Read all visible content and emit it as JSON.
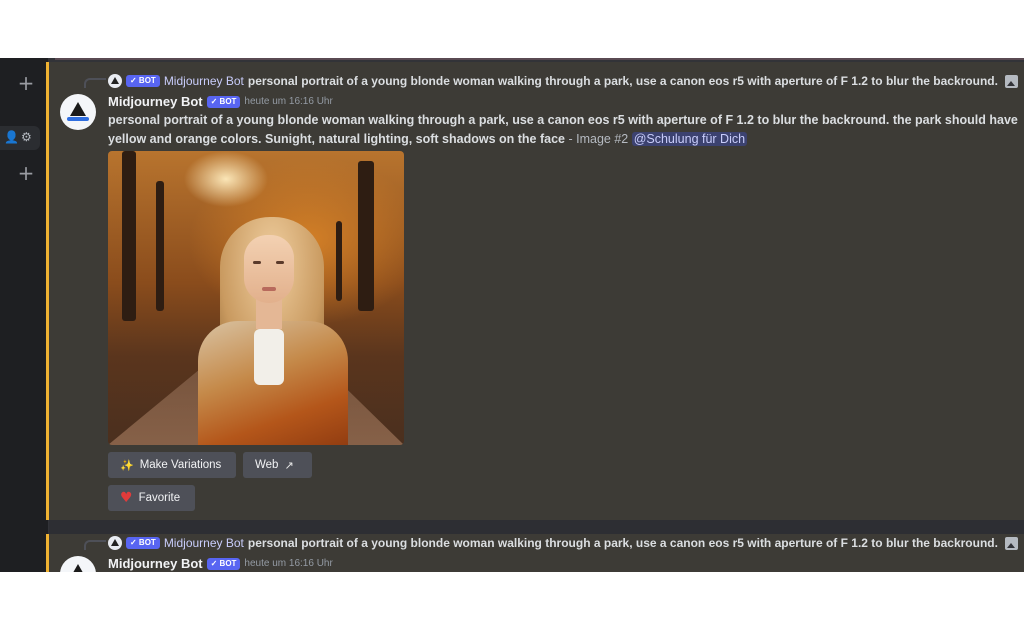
{
  "messages": [
    {
      "reply": {
        "author": "Midjourney Bot",
        "badge": "✓ BOT",
        "text": "personal portrait of a young blonde woman walking through a park, use a canon eos r5 with aperture of F 1.2 to blur the backround. the park should have yellow and orange colors. Sunight, natural lighting, soft shadows on the face"
      },
      "author": "Midjourney Bot",
      "badge": "✓ BOT",
      "timestamp": "heute um 16:16 Uhr",
      "prompt": "personal portrait of a young blonde woman walking through a park, use a canon eos r5 with aperture of F 1.2 to blur the backround. the park should have yellow and orange colors. Sunight, natural lighting, soft shadows on the face",
      "suffix": " - Image #2 ",
      "mention": "@Schulung für Dich",
      "buttons": {
        "variations": "Make Variations",
        "web": "Web",
        "favorite": "Favorite"
      }
    },
    {
      "reply": {
        "author": "Midjourney Bot",
        "badge": "✓ BOT",
        "text": "personal portrait of a young blonde woman walking through a park, use a canon eos r5 with aperture of F 1.2 to blur the backround. the park should have yellow and orange colors. Sunight, natural lighting, soft shadows on the face"
      },
      "author": "Midjourney Bot",
      "badge": "✓ BOT",
      "timestamp": "heute um 16:16 Uhr"
    }
  ],
  "icons": {
    "rail_top": "plus-icon",
    "rail_settings": [
      "add-friend-icon",
      "gear-icon"
    ],
    "rail_bottom": "plus-icon",
    "variations": "sparkle-icon",
    "web": "external-link-icon",
    "favorite": "heart-icon",
    "reply_end": "image-icon"
  },
  "colors": {
    "highlight": "#f0b232",
    "bot_badge": "#5865f2",
    "mention_bg": "#3c4270",
    "background": "#323338"
  }
}
